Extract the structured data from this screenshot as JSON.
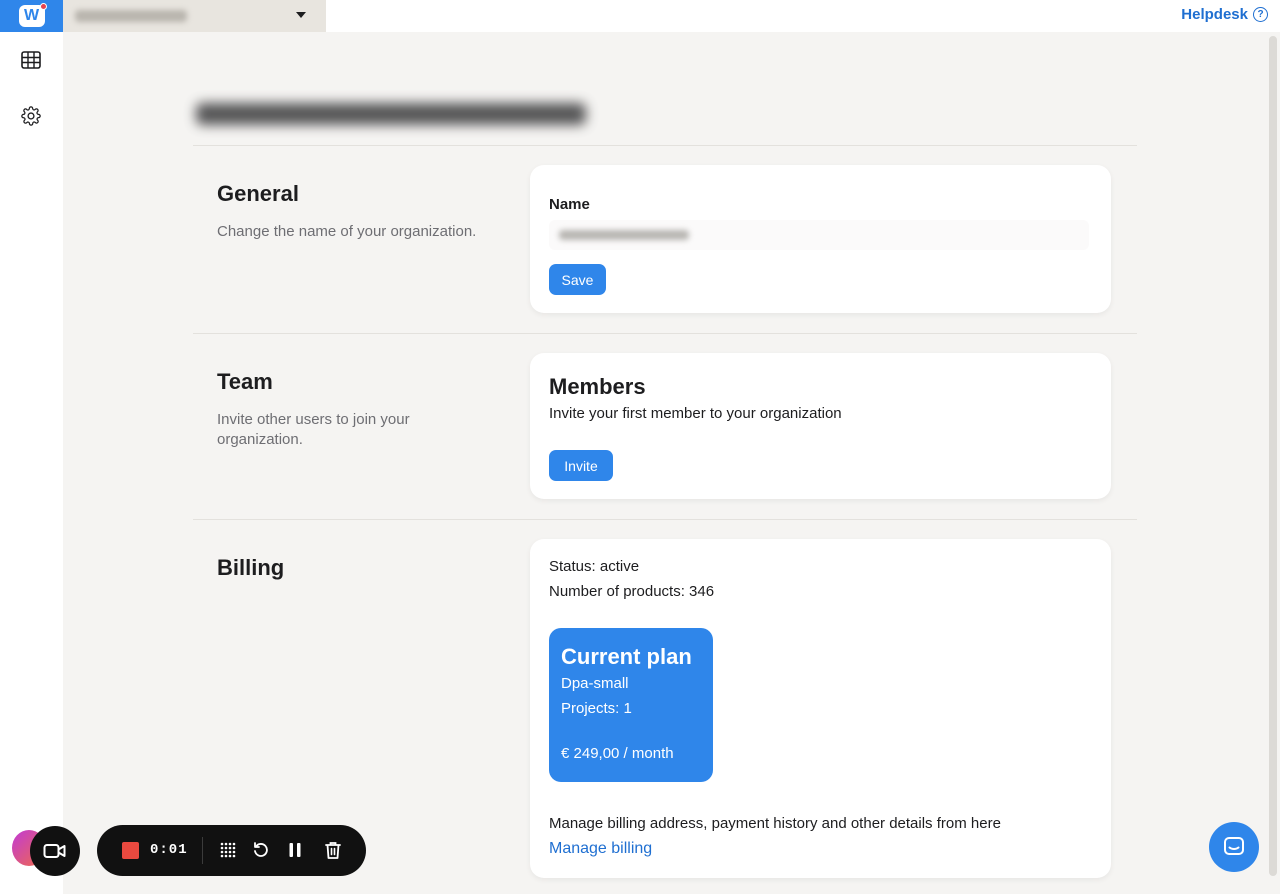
{
  "topbar": {
    "logo_alt": "W",
    "helpdesk_label": "Helpdesk",
    "helpdesk_icon": "?"
  },
  "sidebar": {
    "items": [
      {
        "icon": "table-grid-icon"
      },
      {
        "icon": "gear-icon"
      }
    ]
  },
  "sections": {
    "general": {
      "heading": "General",
      "description": "Change the name of your organization.",
      "name_label": "Name",
      "save_label": "Save"
    },
    "team": {
      "heading": "Team",
      "description": "Invite other users to join your organization.",
      "members_title": "Members",
      "members_desc": "Invite your first member to your organization",
      "invite_label": "Invite"
    },
    "billing": {
      "heading": "Billing",
      "status_line": "Status: active",
      "products_line": "Number of products: 346",
      "plan": {
        "title": "Current plan",
        "name": "Dpa-small",
        "projects": "Projects: 1",
        "price": "€ 249,00 / month"
      },
      "manage_desc": "Manage billing address, payment history and other details from here",
      "manage_link": "Manage billing"
    }
  },
  "recorder": {
    "time": "0:01"
  },
  "colors": {
    "accent": "#2f86ea",
    "link": "#1f6fd1",
    "background": "#f5f4f2",
    "record_red": "#e9493f"
  }
}
